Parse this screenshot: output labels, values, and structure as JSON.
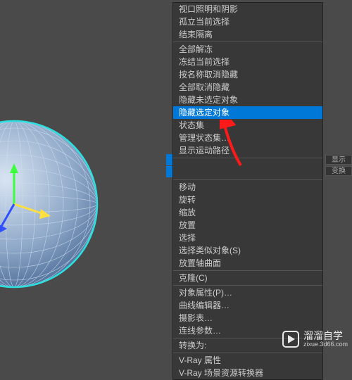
{
  "menu": {
    "items": [
      {
        "label": "视口照明和阴影",
        "sep": false
      },
      {
        "label": "孤立当前选择",
        "sep": false
      },
      {
        "label": "结束隔离",
        "sep": true
      },
      {
        "label": "全部解冻",
        "sep": false
      },
      {
        "label": "冻结当前选择",
        "sep": false
      },
      {
        "label": "按名称取消隐藏",
        "sep": false
      },
      {
        "label": "全部取消隐藏",
        "sep": false
      },
      {
        "label": "隐藏未选定对象",
        "sep": false
      },
      {
        "label": "隐藏选定对象",
        "sep": false,
        "highlighted": true
      },
      {
        "label": "状态集",
        "sep": false
      },
      {
        "label": "管理状态集…",
        "sep": false
      },
      {
        "label": "显示运动路径",
        "sep": true
      },
      {
        "label": "",
        "sep": true,
        "gap": true
      },
      {
        "label": "移动",
        "sep": false
      },
      {
        "label": "旋转",
        "sep": false
      },
      {
        "label": "缩放",
        "sep": false
      },
      {
        "label": "放置",
        "sep": false
      },
      {
        "label": "选择",
        "sep": false
      },
      {
        "label": "选择类似对象(S)",
        "sep": false
      },
      {
        "label": "放置轴曲面",
        "sep": true
      },
      {
        "label": "克隆(C)",
        "sep": true
      },
      {
        "label": "对象属性(P)…",
        "sep": false
      },
      {
        "label": "曲线编辑器…",
        "sep": false
      },
      {
        "label": "摄影表…",
        "sep": false
      },
      {
        "label": "连线参数…",
        "sep": true
      },
      {
        "label": "转换为:",
        "sep": true
      },
      {
        "label": "V-Ray 属性",
        "sep": false
      },
      {
        "label": "V-Ray 场景资源转换器",
        "sep": false
      }
    ]
  },
  "right_tabs": {
    "top": "显示",
    "bottom": "变换"
  },
  "watermark": {
    "brand": "溜溜自学",
    "url": "zixue.3d66.com"
  }
}
